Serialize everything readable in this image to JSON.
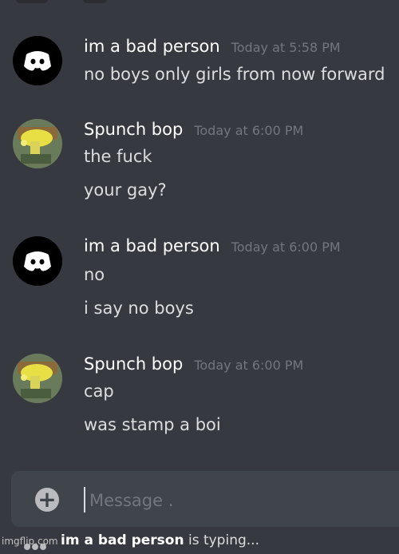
{
  "messages": [
    {
      "author": "im a bad person",
      "timestamp": "Today at 5:58 PM",
      "lines": [
        "no boys only girls from now forward"
      ],
      "avatar": "discord-logo-icon"
    },
    {
      "author": "Spunch bop",
      "timestamp": "Today at 6:00 PM",
      "lines": [
        "the fuck",
        "your gay?"
      ],
      "avatar": "spongebob-avatar"
    },
    {
      "author": "im a bad person",
      "timestamp": "Today at 6:00 PM",
      "lines": [
        "no",
        "i say no boys"
      ],
      "avatar": "discord-logo-icon"
    },
    {
      "author": "Spunch bop",
      "timestamp": "Today at 6:00 PM",
      "lines": [
        "cap",
        "was stamp a boi"
      ],
      "avatar": "spongebob-avatar"
    }
  ],
  "composer": {
    "placeholder": "Message ."
  },
  "typing": {
    "user": "im a bad person",
    "suffix": " is typing..."
  },
  "watermark": "imgflip.com",
  "colors": {
    "background": "#36393f",
    "input": "#40444b",
    "timestamp": "#72767d",
    "discord_avatar_bg": "#000000"
  }
}
